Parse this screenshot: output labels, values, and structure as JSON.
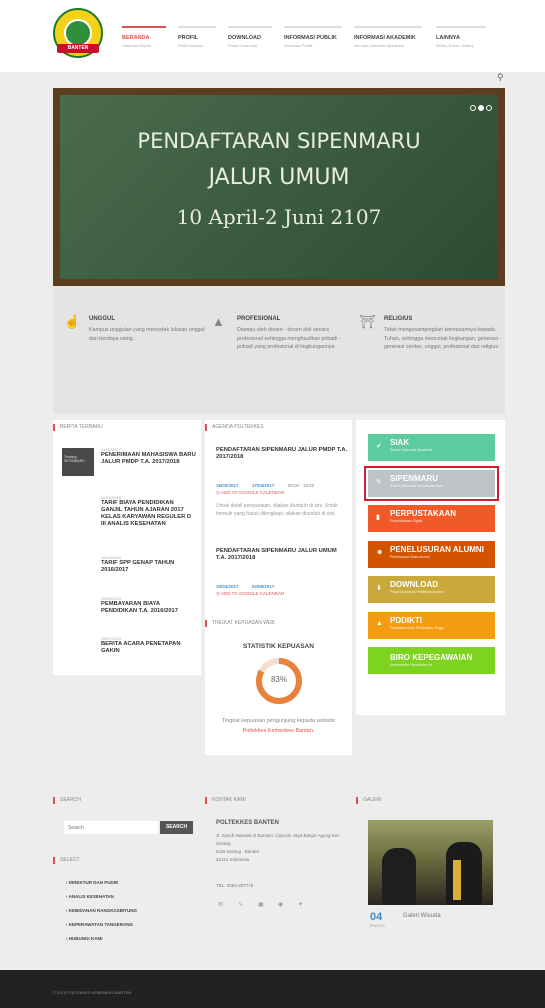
{
  "logo": {
    "ribbon": "BANTEN"
  },
  "nav": [
    {
      "title": "BERANDA",
      "sub": "Halaman Depan"
    },
    {
      "title": "PROFIL",
      "sub": "Profil Kampus"
    },
    {
      "title": "DOWNLOAD",
      "sub": "Pusat Download"
    },
    {
      "title": "INFORMASI PUBLIK",
      "sub": "Informasi Publik"
    },
    {
      "title": "INFORMASI AKADEMIK",
      "sub": "Info dan Kalender Akademik"
    },
    {
      "title": "LAINNYA",
      "sub": "Berita, Event, Gallery"
    }
  ],
  "icons": {
    "search": "search-icon",
    "like": "thumbs-up-icon",
    "cap": "graduation-cap-icon",
    "temple": "institution-icon"
  },
  "slider": {
    "line1": "PENDAFTARAN SIPENMARU",
    "line2": "JALUR UMUM",
    "line3": "10 April-2 Juni 2107"
  },
  "features": [
    {
      "title": "UNGGUL",
      "desc": "Kampus unggulan yang mencetak lulusan unggul dan berdaya saing."
    },
    {
      "title": "PROFESIONAL",
      "desc": "Diampu oleh dosen - dosen ahli secara profesional sehingga menghasilkan pribadi - pribadi yang profesional di lingkungannya"
    },
    {
      "title": "RELIGIUS",
      "desc": "Tidak mengesampingkan keimanannya kepada Tuhan, sehingga mencetak lingkungan, generasi - generasi cerdas, unggul, profesional dan religius."
    }
  ],
  "news": {
    "heading": "BERITA TERBARU",
    "items": [
      {
        "date": "21/02/2017",
        "title": "PENERIMAAN MAHASISWA BARU JALUR PMDP T.A. 2017/2018",
        "thumb": "Tentang SIPENMARU"
      },
      {
        "date": "16/12/2016",
        "title": "TARIF BIAYA PENDIDIKAN GANJIL TAHUN AJARAN 2017 KELAS KARYAWAN REGULER D III ANALIS KESEHATAN"
      },
      {
        "date": "15/12/2016",
        "title": "TARIF SPP GENAP TAHUN 2016/2017"
      },
      {
        "date": "12/09/2016",
        "title": "PEMBAYARAN BIAYA PENDIDIKAN T.A. 2016/2017"
      },
      {
        "date": "26/07/2016",
        "title": "BERITA ACARA PENETAPAN GAKIN"
      }
    ]
  },
  "agenda": {
    "heading": "AGENDA POLTEKKES",
    "items": [
      {
        "title": "PENDAFTARAN SIPENMARU JALUR PMDP T.A. 2017/2018",
        "d1": "16/02/2017",
        "d2": "17/04/2017",
        "time": "09:00 - 15:00",
        "cal": "ADD TO GOOGLE CALENDAR",
        "desc": "Untuk detail persyaratan, silakan diunduh di sini. Untuk formulir yang harus dilengkapi, silakan diunduh di sini."
      },
      {
        "title": "PENDAFTARAN SIPENMARU JALUR UMUM T.A. 2017/2018",
        "d1": "10/04/2017",
        "d2": "02/06/2017",
        "cal": "ADD TO GOOGLE CALENDAR"
      }
    ]
  },
  "survey": {
    "heading": "TINGKAT KEPUASAN WEB",
    "title": "STATISTIK KEPUASAN",
    "value": "83%",
    "percent": 83,
    "text": "Tingkat kepuasan pengunjung kepada website",
    "link": "Poltekkes Kemenkes Banten."
  },
  "services": [
    {
      "title": "SIAK",
      "sub": "Sistem Informasi Akademik",
      "color": "#5ccba0",
      "icon": "check-icon"
    },
    {
      "title": "SIPENMARU",
      "sub": "Sistem Informasi Mahasiswa Baru",
      "color": "#bdc3c7",
      "icon": "pencil-icon"
    },
    {
      "title": "PERPUSTAKAAN",
      "sub": "Perpustakaan Digital",
      "color": "#f05a28",
      "icon": "book-icon"
    },
    {
      "title": "PENELUSURAN ALUMNI",
      "sub": "Penelusuran Data Alumni",
      "color": "#d35400",
      "icon": "users-icon"
    },
    {
      "title": "DOWNLOAD",
      "sub": "Pusat Download Poltekkes Banten",
      "color": "#c9a93c",
      "icon": "download-icon"
    },
    {
      "title": "PDDIKTI",
      "sub": "Pangkalan Data Pendidikan Tinggi",
      "color": "#f39c12",
      "icon": "cap-icon"
    },
    {
      "title": "BIRO KEPEGAWAIAN",
      "sub": "Kementerian Kesehatan RI",
      "color": "#7ed321",
      "icon": "none"
    }
  ],
  "footer": {
    "search_heading": "SEARCH",
    "search_placeholder": "Search",
    "search_btn": "SEARCH",
    "select_heading": "SELECT",
    "links": [
      "DIREKTUR DAN PUDIR",
      "ANALIS KESEHATAN",
      "KEBIDANAN RANGKASBITUNG",
      "KEPERAWATAN TANGERANG",
      "HUBUNGI KAMI"
    ],
    "contact_heading": "KONTAK KAMI",
    "org": "POLTEKKES BANTEN",
    "addr": [
      "Jl. Syech Nawawi Al Bantani, Cipocok Jaya Banjar Agung Kec. Serang",
      "Kota Serang , Banten",
      "42121 Indonesia"
    ],
    "tel": "TEL: 0254-207776",
    "gallery_heading": "GALERI",
    "gallery_count": "04",
    "gallery_unit": "PHOTOS",
    "gallery_label": "Galeri Wisuda",
    "copyright": "© 2015 POLTEKKES KEMENKES BANTEN"
  }
}
